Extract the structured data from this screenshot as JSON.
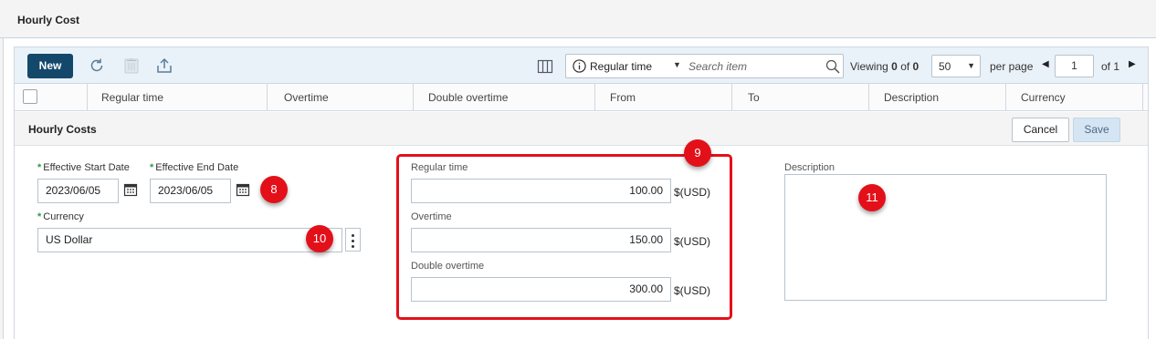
{
  "page": {
    "title": "Hourly Cost"
  },
  "toolbar": {
    "new_label": "New",
    "refresh_icon": "refresh-icon",
    "delete_icon": "trash-icon",
    "export_icon": "export-icon",
    "columns_icon": "columns-icon",
    "search": {
      "scope": "Regular time",
      "placeholder": "Search item",
      "value": ""
    },
    "viewing_prefix": "Viewing",
    "viewing_from": "0",
    "viewing_of_word": "of",
    "viewing_total": "0",
    "per_page_value": "50",
    "per_page_label": "per page",
    "page_number": "1",
    "page_of": "of 1"
  },
  "table": {
    "columns": [
      "Regular time",
      "Overtime",
      "Double overtime",
      "From",
      "To",
      "Description",
      "Currency"
    ]
  },
  "edit_form": {
    "title": "Hourly Costs",
    "cancel_label": "Cancel",
    "save_label": "Save",
    "effective_start": {
      "label": "Effective Start Date",
      "value": "2023/06/05"
    },
    "effective_end": {
      "label": "Effective End Date",
      "value": "2023/06/05"
    },
    "currency": {
      "label": "Currency",
      "value": "US Dollar"
    },
    "regular_time": {
      "label": "Regular time",
      "value": "100.00",
      "unit": "$(USD)"
    },
    "overtime": {
      "label": "Overtime",
      "value": "150.00",
      "unit": "$(USD)"
    },
    "double_overtime": {
      "label": "Double overtime",
      "value": "300.00",
      "unit": "$(USD)"
    },
    "description": {
      "label": "Description",
      "value": ""
    }
  },
  "annotations": {
    "markers": [
      "8",
      "9",
      "10",
      "11"
    ],
    "highlight_color": "#e3101a"
  },
  "colors": {
    "primary_button": "#14486b",
    "toolbar_bg": "#eaf2f9",
    "required_mark": "#2e9b4a",
    "save_disabled_bg": "#d5e5f3"
  }
}
